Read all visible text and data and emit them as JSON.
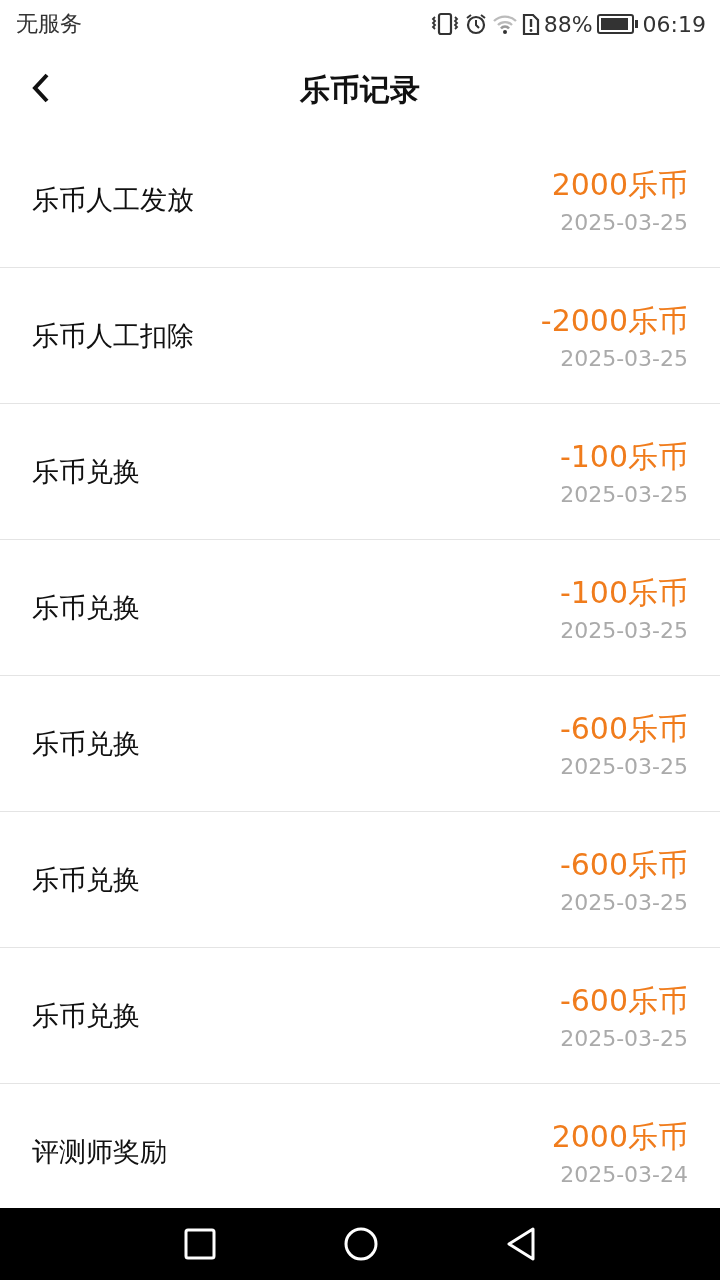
{
  "status_bar": {
    "carrier": "无服务",
    "battery_percent": "88%",
    "time": "06:19"
  },
  "header": {
    "title": "乐币记录"
  },
  "records": [
    {
      "title": "乐币人工发放",
      "amount": "2000乐币",
      "date": "2025-03-25"
    },
    {
      "title": "乐币人工扣除",
      "amount": "-2000乐币",
      "date": "2025-03-25"
    },
    {
      "title": "乐币兑换",
      "amount": "-100乐币",
      "date": "2025-03-25"
    },
    {
      "title": "乐币兑换",
      "amount": "-100乐币",
      "date": "2025-03-25"
    },
    {
      "title": "乐币兑换",
      "amount": "-600乐币",
      "date": "2025-03-25"
    },
    {
      "title": "乐币兑换",
      "amount": "-600乐币",
      "date": "2025-03-25"
    },
    {
      "title": "乐币兑换",
      "amount": "-600乐币",
      "date": "2025-03-25"
    },
    {
      "title": "评测师奖励",
      "amount": "2000乐币",
      "date": "2025-03-24"
    }
  ]
}
